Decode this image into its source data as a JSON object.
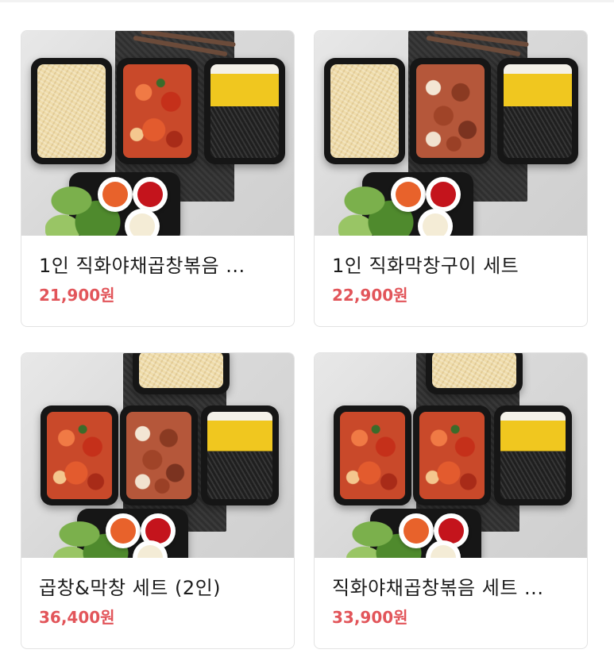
{
  "colors": {
    "price": "#e2555a",
    "title": "#1c1c1c",
    "card_border": "#e3e3e3"
  },
  "products": [
    {
      "name": "1인 직화야채곱창볶음 ...",
      "price": "21,900원"
    },
    {
      "name": "1인 직화막창구이 세트",
      "price": "22,900원"
    },
    {
      "name": "곱창&막창 세트 (2인)",
      "price": "36,400원"
    },
    {
      "name": "직화야채곱창볶음 세트 ...",
      "price": "33,900원"
    }
  ]
}
